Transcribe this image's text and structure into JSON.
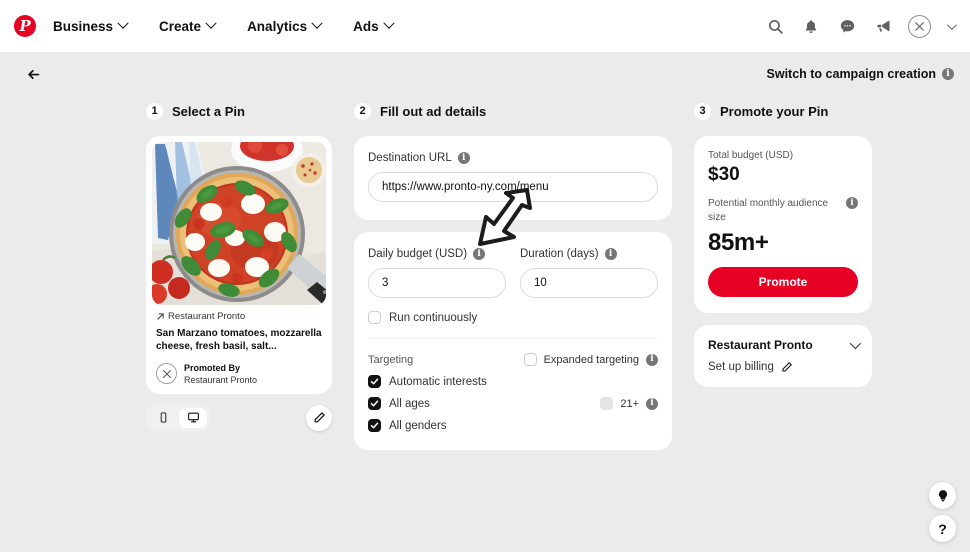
{
  "header": {
    "logo": "pinterest-logo",
    "nav": [
      {
        "label": "Business",
        "icon": "chevron-down-icon"
      },
      {
        "label": "Create",
        "icon": "chevron-down-icon"
      },
      {
        "label": "Analytics",
        "icon": "chevron-down-icon"
      },
      {
        "label": "Ads",
        "icon": "chevron-down-icon"
      }
    ],
    "icons": [
      "search-icon",
      "bell-icon",
      "chat-bubble-icon",
      "megaphone-icon",
      "avatar-icon",
      "chevron-down-icon"
    ]
  },
  "subheader": {
    "back": "back-arrow-icon",
    "switch_label": "Switch to campaign creation",
    "switch_info": "info-icon"
  },
  "steps": {
    "one": {
      "num": "1",
      "title": "Select a Pin"
    },
    "two": {
      "num": "2",
      "title": "Fill out ad details"
    },
    "three": {
      "num": "3",
      "title": "Promote your Pin"
    }
  },
  "pin": {
    "image_alt": "margherita-pizza-photo",
    "source": "Restaurant Pronto",
    "title": "San Marzano tomatoes, mozzarella cheese, fresh basil, salt...",
    "promoted_by_label": "Promoted By",
    "promoted_by_name": "Restaurant Pronto",
    "device_mobile": "mobile-icon",
    "device_desktop": "desktop-icon",
    "edit": "pencil-icon"
  },
  "ad_details": {
    "destination_url_label": "Destination URL",
    "destination_url_value": "https://www.pronto-ny.com/menu",
    "destination_url_placeholder": "https://",
    "daily_budget_label": "Daily budget (USD)",
    "daily_budget_value": "3",
    "duration_label": "Duration (days)",
    "duration_value": "10",
    "run_continuously_label": "Run continuously",
    "run_continuously_checked": false,
    "targeting_label": "Targeting",
    "expanded_targeting_label": "Expanded targeting",
    "expanded_targeting_checked": false,
    "options": [
      {
        "label": "Automatic interests",
        "checked": true
      },
      {
        "label": "All ages",
        "checked": true
      },
      {
        "label": "All genders",
        "checked": true
      }
    ],
    "age_gate_label": "21+",
    "age_gate_checked": false
  },
  "promote": {
    "total_budget_label": "Total budget (USD)",
    "total_budget_value": "$30",
    "audience_label": "Potential monthly audience size",
    "audience_value": "85m+",
    "promote_button": "Promote"
  },
  "billing": {
    "account_name": "Restaurant Pronto",
    "setup_label": "Set up billing",
    "edit_icon": "pencil-icon"
  },
  "fabs": {
    "idea": "lightbulb-icon",
    "help": "?"
  },
  "colors": {
    "brand_red": "#e60023",
    "page_bg": "#ebebeb",
    "card_bg": "#ffffff",
    "text_primary": "#111111"
  }
}
